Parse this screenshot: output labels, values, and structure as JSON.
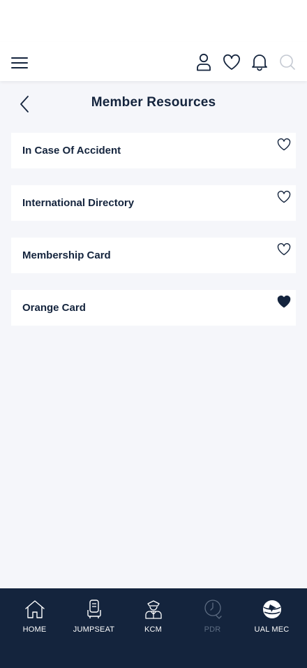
{
  "header": {
    "icons": [
      "menu-icon",
      "user-icon",
      "heart-icon",
      "bell-icon",
      "search-icon"
    ]
  },
  "page": {
    "title": "Member Resources",
    "back_icon": "chevron-left-icon"
  },
  "resources": [
    {
      "label": "In Case Of Accident",
      "favorite": false
    },
    {
      "label": "International Directory",
      "favorite": false
    },
    {
      "label": "Membership Card",
      "favorite": false
    },
    {
      "label": "Orange Card",
      "favorite": true
    }
  ],
  "bottom_nav": {
    "items": [
      {
        "label": "HOME",
        "icon": "home-icon",
        "enabled": true
      },
      {
        "label": "JUMPSEAT",
        "icon": "seat-icon",
        "enabled": true
      },
      {
        "label": "KCM",
        "icon": "pilot-icon",
        "enabled": true
      },
      {
        "label": "PDR",
        "icon": "clock-icon",
        "enabled": false
      },
      {
        "label": "UAL MEC",
        "icon": "globe-logo-icon",
        "enabled": true
      }
    ]
  },
  "colors": {
    "navy": "#14243d",
    "background": "#f5f6fa",
    "card": "#ffffff",
    "disabled": "#5d6c82",
    "icon_gray": "#c4c9d2"
  }
}
